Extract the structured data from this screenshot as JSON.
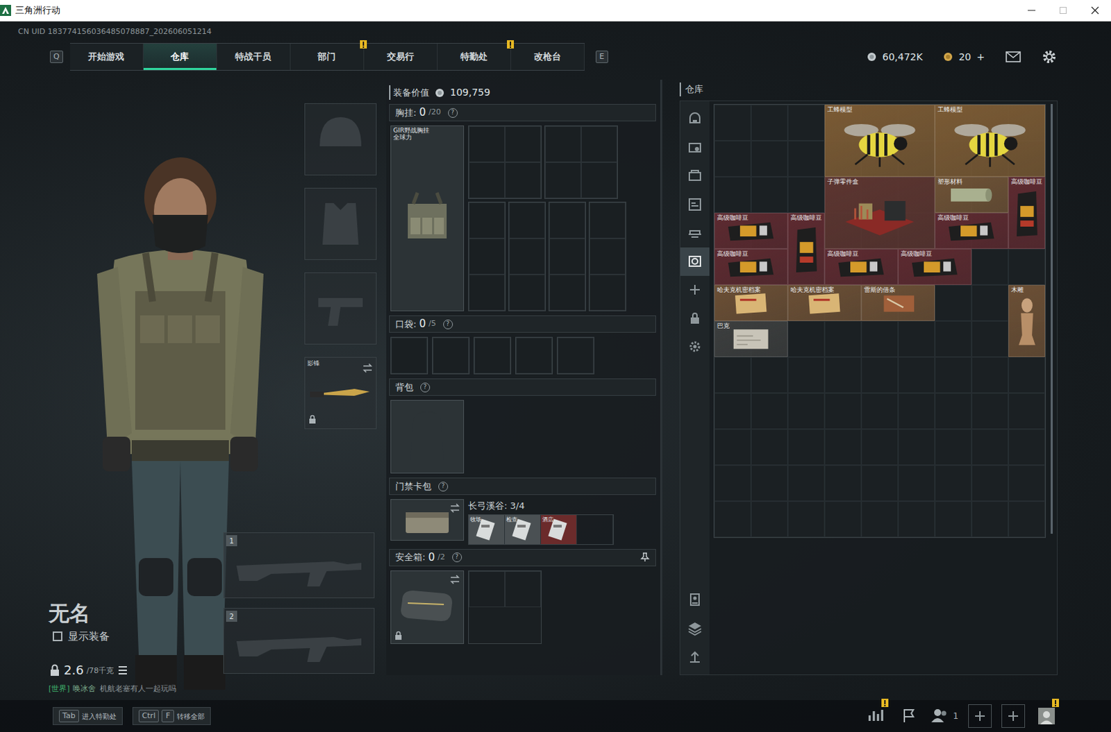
{
  "window": {
    "title": "三角洲行动"
  },
  "uid": "CN UID 183774156036485078887_202606051214",
  "nav": {
    "prev_key": "Q",
    "next_key": "E",
    "tabs": [
      {
        "label": "开始游戏",
        "selected": false,
        "notify": false
      },
      {
        "label": "仓库",
        "selected": true,
        "notify": false
      },
      {
        "label": "特战干员",
        "selected": false,
        "notify": false
      },
      {
        "label": "部门",
        "selected": false,
        "notify": true
      },
      {
        "label": "交易行",
        "selected": false,
        "notify": false
      },
      {
        "label": "特勤处",
        "selected": false,
        "notify": true
      },
      {
        "label": "改枪台",
        "selected": false,
        "notify": false
      }
    ]
  },
  "currency": {
    "coins": "60,472K",
    "tickets": "20",
    "add": "+"
  },
  "player": {
    "name": "无名",
    "show_gear": {
      "label": "显示装备",
      "checked": false
    },
    "weight": "2.6",
    "weight_max": "/78千克"
  },
  "chat": {
    "channel": "[世界]",
    "sender": "唤冰舍",
    "message": "机航老塞有人一起玩吗"
  },
  "equipment": [
    {
      "kind": "helmet",
      "locked": false,
      "swap": false
    },
    {
      "kind": "armor",
      "locked": false,
      "swap": false
    },
    {
      "kind": "pistol",
      "locked": false,
      "swap": false
    },
    {
      "kind": "melee",
      "label": "影锋",
      "locked": true,
      "swap": true
    }
  ],
  "weapons": [
    {
      "number": "1"
    },
    {
      "number": "2"
    }
  ],
  "loadout": {
    "value_label": "装备价值",
    "value": "109,759",
    "rig": {
      "label": "胸挂:",
      "count": "0",
      "capacity": "/20",
      "help": "?",
      "item": {
        "name": "GIR野战胸挂",
        "sub": "全球力"
      }
    },
    "pockets": {
      "label": "口袋:",
      "count": "0",
      "capacity": "/5",
      "help": "?"
    },
    "backpack": {
      "label": "背包",
      "help": "?"
    },
    "keycards": {
      "label": "门禁卡包",
      "help": "?",
      "map": "长弓溪谷: 3/4",
      "cards": [
        {
          "name": "牧场…",
          "filled": true,
          "color": "#4a5053"
        },
        {
          "name": "检查…",
          "filled": true,
          "color": "#4a5053"
        },
        {
          "name": "酒店…",
          "filled": true,
          "color": "#6b2b2b"
        },
        {
          "filled": false
        }
      ]
    },
    "safe": {
      "label": "安全箱:",
      "count": "0",
      "capacity": "/2",
      "help": "?"
    }
  },
  "stash": {
    "title": "仓库",
    "sidebar_top": [
      {
        "selected": false
      },
      {
        "selected": false
      },
      {
        "selected": false
      },
      {
        "selected": false
      },
      {
        "selected": false
      },
      {
        "selected": true
      },
      {
        "selected": false
      },
      {
        "selected": false
      },
      {
        "selected": false
      }
    ],
    "sidebar_bottom": [
      {
        "selected": false
      },
      {
        "selected": false
      },
      {
        "selected": false
      }
    ],
    "items": [
      {
        "name": "工蜂模型",
        "color": "#7a5a34"
      },
      {
        "name": "工蜂模型",
        "color": "#7a5a34"
      },
      {
        "name": "子弹零件盒",
        "color": "#5c3530"
      },
      {
        "name": "塑形材料",
        "color": "#6e5236"
      },
      {
        "name": "高级咖啡豆",
        "color": "#5d2a30"
      },
      {
        "name": "高级咖啡豆",
        "color": "#5d2a30"
      },
      {
        "name": "高级咖啡豆",
        "color": "#5d2a30"
      },
      {
        "name": "高级咖啡豆",
        "color": "#5d2a30"
      },
      {
        "name": "高级咖啡豆",
        "color": "#5d2a30"
      },
      {
        "name": "高级咖啡豆",
        "color": "#5d2a30"
      },
      {
        "name": "高级咖啡豆",
        "color": "#5d2a30"
      },
      {
        "name": "哈夫克机密档案",
        "color": "#6b4f35"
      },
      {
        "name": "哈夫克机密档案",
        "color": "#6b4f35"
      },
      {
        "name": "雷斯的借条",
        "color": "#6b4f35"
      },
      {
        "name": "木雕",
        "color": "#6b4f35"
      },
      {
        "name": "巴克",
        "color": "#3c3e3e"
      }
    ]
  },
  "bottom": {
    "hints": [
      {
        "keys": [
          "Tab"
        ],
        "label": "进入特勤处"
      },
      {
        "keys": [
          "Ctrl",
          "F"
        ],
        "label": "转移全部"
      }
    ],
    "tools": [
      {
        "kind": "stats",
        "alert": true
      },
      {
        "kind": "flag",
        "alert": false
      },
      {
        "kind": "friends",
        "alert": false,
        "count": "1"
      },
      {
        "kind": "slot",
        "alert": false
      },
      {
        "kind": "slot",
        "alert": false
      },
      {
        "kind": "avatar",
        "alert": true
      }
    ]
  }
}
